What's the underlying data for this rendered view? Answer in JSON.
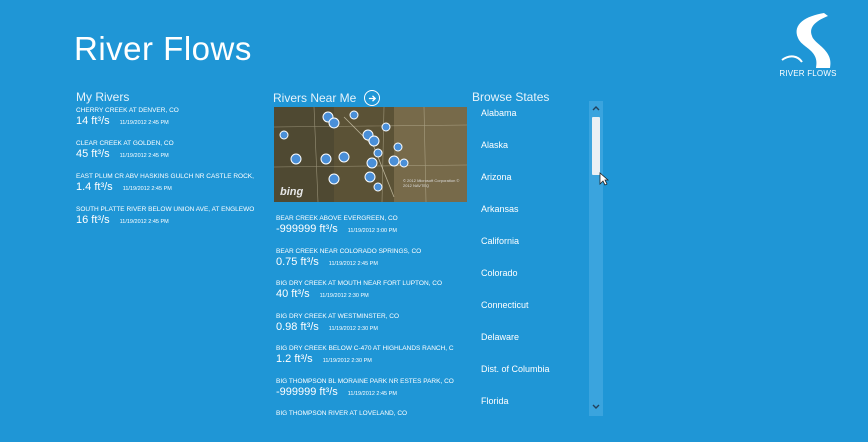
{
  "app": {
    "title": "River Flows",
    "logo_text": "RIVER FLOWS"
  },
  "my_rivers": {
    "title": "My Rivers",
    "items": [
      {
        "name": "CHERRY CREEK AT DENVER, CO",
        "flow": "14 ft³/s",
        "time": "11/19/2012 2:45 PM"
      },
      {
        "name": "CLEAR CREEK AT GOLDEN, CO",
        "flow": "45 ft³/s",
        "time": "11/19/2012 2:45 PM"
      },
      {
        "name": "EAST PLUM CR ABV HASKINS GULCH NR CASTLE ROCK,",
        "flow": "1.4 ft³/s",
        "time": "11/19/2012 2:45 PM"
      },
      {
        "name": "SOUTH PLATTE RIVER BELOW UNION AVE, AT ENGLEWO",
        "flow": "16 ft³/s",
        "time": "11/19/2012 2:45 PM"
      }
    ]
  },
  "rivers_near_me": {
    "title": "Rivers Near Me",
    "map_brand": "bing",
    "map_copyright": "© 2012 Microsoft Corporation © 2012 NAVTEQ",
    "items": [
      {
        "name": "BEAR CREEK ABOVE EVERGREEN, CO",
        "flow": "-999999 ft³/s",
        "time": "11/19/2012 3:00 PM"
      },
      {
        "name": "BEAR CREEK NEAR COLORADO SPRINGS, CO",
        "flow": "0.75 ft³/s",
        "time": "11/19/2012 2:45 PM"
      },
      {
        "name": "BIG DRY CREEK AT MOUTH NEAR FORT LUPTON, CO",
        "flow": "40 ft³/s",
        "time": "11/19/2012 2:30 PM"
      },
      {
        "name": "BIG DRY CREEK AT WESTMINSTER, CO",
        "flow": "0.98 ft³/s",
        "time": "11/19/2012 2:30 PM"
      },
      {
        "name": "BIG DRY CREEK BELOW C-470 AT HIGHLANDS RANCH, C",
        "flow": "1.2 ft³/s",
        "time": "11/19/2012 2:30 PM"
      },
      {
        "name": "BIG THOMPSON BL MORAINE PARK NR ESTES PARK, CO",
        "flow": "-999999 ft³/s",
        "time": "11/19/2012 2:45 PM"
      },
      {
        "name": "BIG THOMPSON RIVER AT LOVELAND, CO",
        "flow": "",
        "time": ""
      }
    ]
  },
  "browse_states": {
    "title": "Browse States",
    "items": [
      "Alabama",
      "Alaska",
      "Arizona",
      "Arkansas",
      "California",
      "Colorado",
      "Connecticut",
      "Delaware",
      "Dist. of Columbia",
      "Florida"
    ]
  },
  "scrollbar": {
    "up_icon": "chevron-up-icon",
    "down_icon": "chevron-down-icon"
  },
  "colors": {
    "background": "#1f96d6",
    "text": "#ffffff",
    "scrollbar_track": "#3aa4de",
    "scrollbar_thumb": "#e9f0f5"
  }
}
